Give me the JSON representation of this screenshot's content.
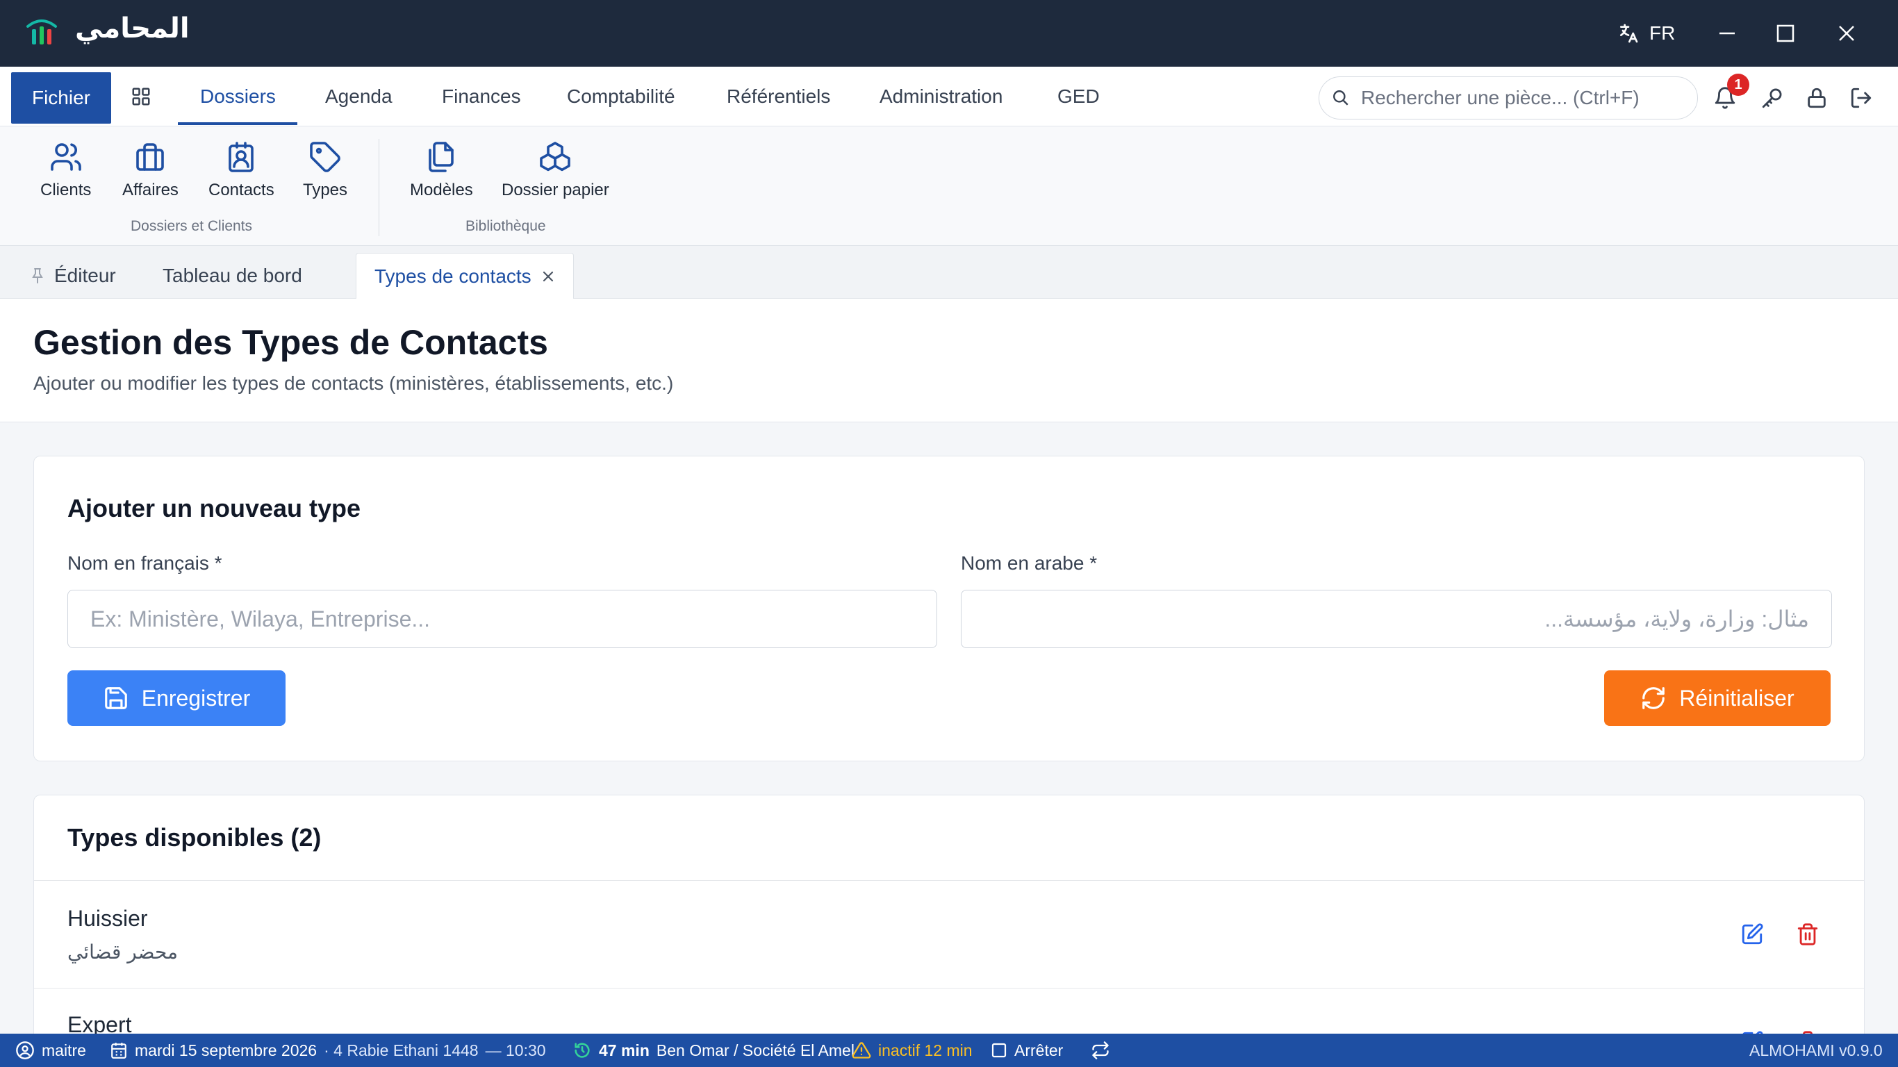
{
  "app": {
    "title": "المحامي"
  },
  "titlebar": {
    "language": "FR"
  },
  "menubar": {
    "fichier": "Fichier",
    "items": [
      "Dossiers",
      "Agenda",
      "Finances",
      "Comptabilité",
      "Référentiels",
      "Administration",
      "GED"
    ],
    "active": "Dossiers",
    "search_placeholder": "Rechercher une pièce... (Ctrl+F)",
    "notification_count": "1"
  },
  "ribbon": {
    "groups": [
      {
        "label": "Dossiers et Clients",
        "buttons": [
          "Clients",
          "Affaires",
          "Contacts",
          "Types"
        ]
      },
      {
        "label": "Bibliothèque",
        "buttons": [
          "Modèles",
          "Dossier papier"
        ]
      }
    ]
  },
  "tabs": [
    "Éditeur",
    "Tableau de bord",
    "Types de contacts"
  ],
  "page": {
    "title": "Gestion des Types de Contacts",
    "subtitle": "Ajouter ou modifier les types de contacts (ministères, établissements, etc.)"
  },
  "form": {
    "title": "Ajouter un nouveau type",
    "fr_label": "Nom en français *",
    "fr_placeholder": "Ex: Ministère, Wilaya, Entreprise...",
    "ar_label": "Nom en arabe *",
    "ar_placeholder": "مثال: وزارة، ولاية، مؤسسة...",
    "save": "Enregistrer",
    "reset": "Réinitialiser"
  },
  "list": {
    "title": "Types disponibles (2)",
    "items": [
      {
        "fr": "Huissier",
        "ar": "محضر قضائي"
      },
      {
        "fr": "Expert",
        "ar": ""
      }
    ]
  },
  "statusbar": {
    "user": "maitre",
    "date": "mardi 15 septembre 2026",
    "hijri": "· 4 Rabie Ethani 1448",
    "time": "— 10:30",
    "timer": "47 min",
    "client": "Ben Omar / Société El Amel",
    "inactive": "inactif 12 min",
    "stop": "Arrêter",
    "version": "ALMOHAMI v0.9.0"
  },
  "colors": {
    "primary": "#1e4fa3",
    "titlebar": "#1e2a3d",
    "save": "#3b82f6",
    "reset": "#f97316",
    "delete": "#dc2626",
    "warning": "#fbbf24"
  }
}
